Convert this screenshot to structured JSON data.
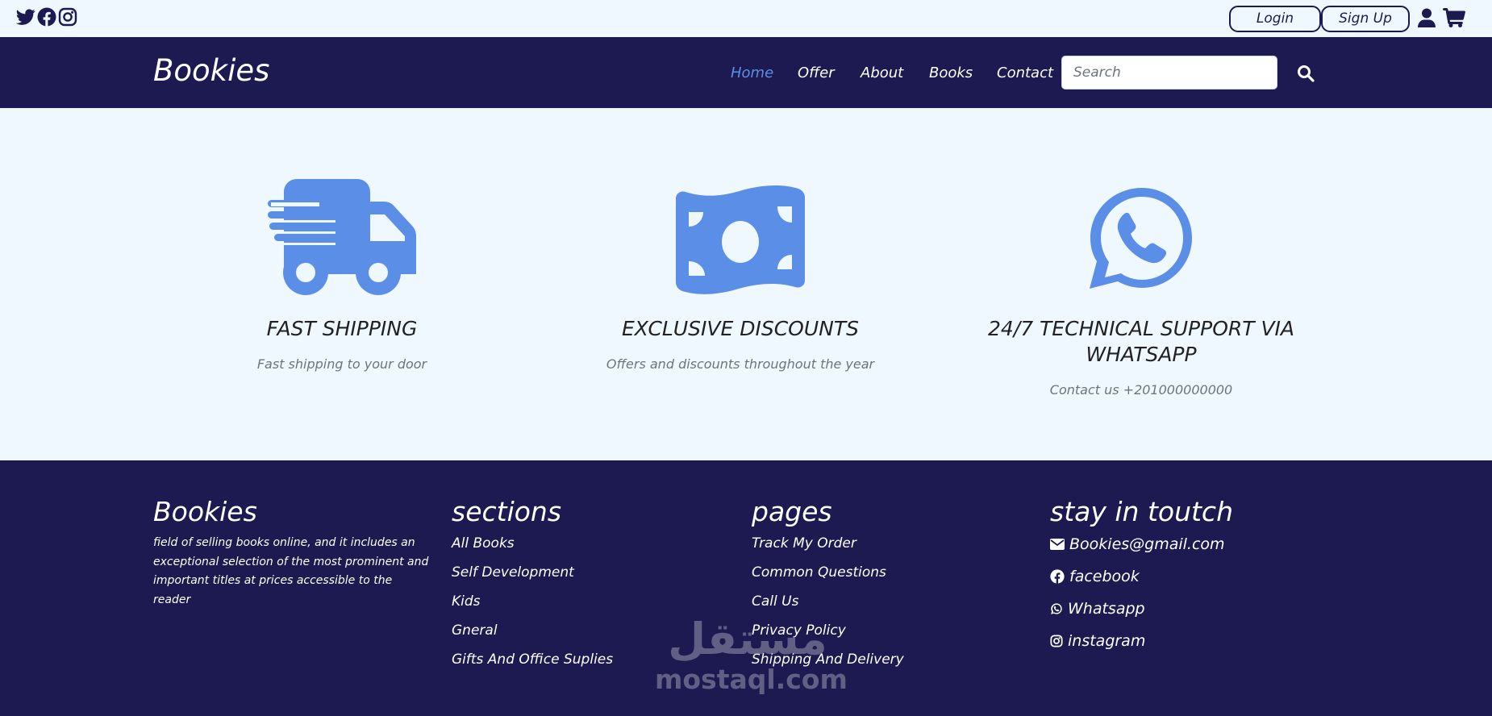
{
  "topbar": {
    "social_icons": [
      "twitter-icon",
      "facebook-icon",
      "instagram-icon"
    ],
    "login_label": "Login",
    "signup_label": "Sign Up",
    "user_icon": "user-icon",
    "cart_icon": "cart-icon"
  },
  "navbar": {
    "brand": "Bookies",
    "links": [
      {
        "label": "Home",
        "active": true
      },
      {
        "label": "Offer",
        "active": false
      },
      {
        "label": "About",
        "active": false
      },
      {
        "label": "Books",
        "active": false
      },
      {
        "label": "Contact",
        "active": false
      }
    ],
    "search_placeholder": "Search",
    "search_icon": "magnifier-icon"
  },
  "features": [
    {
      "icon": "truck-icon",
      "title": "FAST SHIPPING",
      "text": "Fast shipping to your door"
    },
    {
      "icon": "money-bill-icon",
      "title": "EXCLUSIVE DISCOUNTS",
      "text": "Offers and discounts throughout the year"
    },
    {
      "icon": "whatsapp-icon",
      "title": "24/7 TECHNICAL SUPPORT VIA WHATSAPP",
      "text": "Contact us +201000000000"
    }
  ],
  "footer": {
    "about": {
      "heading": "Bookies",
      "description": "field of selling books online, and it includes an exceptional selection of the most prominent and important titles at prices accessible to the reader"
    },
    "sections": {
      "heading": "sections",
      "links": [
        "All Books",
        "Self Development",
        "Kids",
        "Gneral",
        "Gifts And Office Suplies"
      ]
    },
    "pages": {
      "heading": "pages",
      "links": [
        "Track My Order",
        "Common Questions",
        "Call Us",
        "Privacy Policy",
        "Shipping And Delivery"
      ]
    },
    "contact": {
      "heading": "stay in toutch",
      "items": [
        {
          "icon": "envelope-icon",
          "label": "Bookies@gmail.com"
        },
        {
          "icon": "facebook-icon",
          "label": "facebook"
        },
        {
          "icon": "whatsapp-icon",
          "label": "Whatsapp"
        },
        {
          "icon": "instagram-icon",
          "label": "instagram"
        }
      ]
    }
  },
  "watermark": {
    "arabic": "مستقل",
    "latin": "mostaql.com"
  },
  "colors": {
    "navy": "#1c1a50",
    "accent_blue": "#5b8ee6",
    "page_background": "#f0f8ff",
    "muted_text": "#6c757d"
  }
}
